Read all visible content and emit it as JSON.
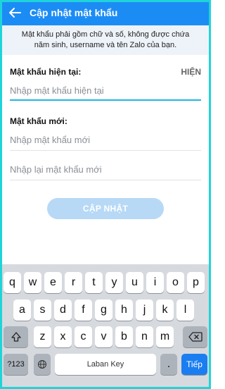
{
  "header": {
    "title": "Cập nhật mật khẩu",
    "back_icon": "arrow-left-icon"
  },
  "notice": {
    "line1": "Mật khẩu phải gồm chữ và số, không được chứa",
    "line2": "năm sinh, username và tên Zalo của bạn."
  },
  "current_password": {
    "label": "Mật khẩu hiện tại:",
    "show_label": "HIỆN",
    "placeholder": "Nhập mật khẩu hiện tại"
  },
  "new_password": {
    "label": "Mật khẩu mới:",
    "placeholder": "Nhập mật khẩu mới",
    "confirm_placeholder": "Nhập lại mật khẩu mới"
  },
  "update_button": {
    "label": "CẬP NHẬT"
  },
  "keyboard": {
    "row1": [
      "q",
      "w",
      "e",
      "r",
      "t",
      "y",
      "u",
      "i",
      "o",
      "p"
    ],
    "row2": [
      "a",
      "s",
      "d",
      "f",
      "g",
      "h",
      "j",
      "k",
      "l"
    ],
    "row3": [
      "z",
      "x",
      "c",
      "v",
      "b",
      "n",
      "m"
    ],
    "numbers_key": "?123",
    "space_label": "Laban Key",
    "period_key": ".",
    "enter_label": "Tiếp"
  },
  "colors": {
    "header_bg": "#1c8cf5",
    "accent": "#1fb5e8",
    "button_disabled": "#b7d9f6",
    "enter_key": "#1a7ef0"
  }
}
